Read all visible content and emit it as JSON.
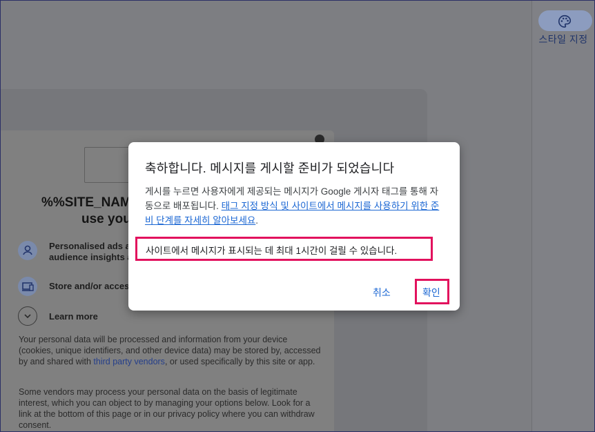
{
  "side_panel": {
    "style_label": "스타일 지정",
    "icon": "palette-icon"
  },
  "consent_preview": {
    "site_title_line1": "%%SITE_NAME%",
    "site_title_line2": "use you",
    "items": [
      {
        "icon": "person-icon",
        "line1": "Personalised ads an",
        "line2": "audience insights an"
      },
      {
        "icon": "devices-icon",
        "line1": "Store and/or access"
      },
      {
        "icon": "chevron-down-icon",
        "line1": "Learn more"
      }
    ],
    "para1_a": "Your personal data will be processed and information from your device (cookies, unique identifiers, and other device data) may be stored by, accessed by and shared with ",
    "para1_link": "third party vendors",
    "para1_b": ", or used specifically by this site or app.",
    "para2": "Some vendors may process your personal data on the basis of legitimate interest, which you can object to by managing your options below. Look for a link at the bottom of this page or in our privacy policy where you can withdraw consent."
  },
  "dialog": {
    "title": "축하합니다. 메시지를 게시할 준비가 되었습니다",
    "body_text": "게시를 누르면 사용자에게 제공되는 메시지가 Google 게시자 태그를 통해 자동으로 배포됩니다. ",
    "body_link": "태그 지정 방식 및 사이트에서 메시지를 사용하기 위한 준비 단계를 자세히 알아보세요",
    "body_end": ".",
    "notice": "사이트에서 메시지가 표시되는 데 최대 1시간이 걸릴 수 있습니다.",
    "cancel_label": "취소",
    "confirm_label": "확인"
  },
  "colors": {
    "accent": "#1a66d3",
    "highlight": "#e2115d"
  }
}
